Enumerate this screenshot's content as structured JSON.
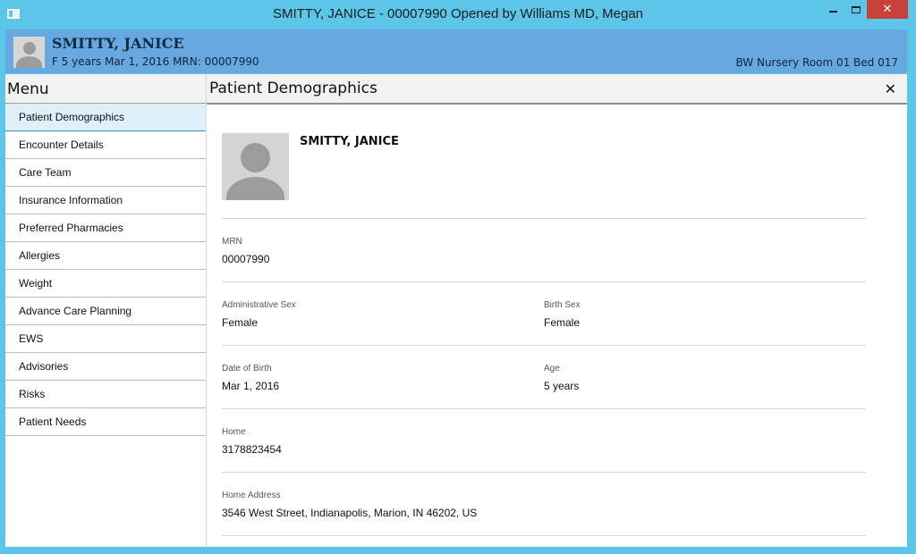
{
  "window": {
    "title": "SMITTY, JANICE - 00007990 Opened by Williams MD, Megan",
    "close_glyph": "✕"
  },
  "header": {
    "name": "SMITTY, JANICE",
    "details": "F 5 years Mar 1, 2016 MRN: 00007990",
    "location": "BW Nursery Room 01 Bed 017"
  },
  "menu": {
    "title": "Menu",
    "items": [
      {
        "label": "Patient Demographics"
      },
      {
        "label": "Encounter Details"
      },
      {
        "label": "Care Team"
      },
      {
        "label": "Insurance Information"
      },
      {
        "label": "Preferred Pharmacies"
      },
      {
        "label": "Allergies"
      },
      {
        "label": "Weight"
      },
      {
        "label": "Advance Care Planning"
      },
      {
        "label": "EWS"
      },
      {
        "label": "Advisories"
      },
      {
        "label": "Risks"
      },
      {
        "label": "Patient Needs"
      }
    ]
  },
  "content": {
    "title": "Patient Demographics",
    "close_glyph": "✕",
    "patient_name": "SMITTY, JANICE",
    "mrn": {
      "label": "MRN",
      "value": "00007990"
    },
    "admin_sex": {
      "label": "Administrative Sex",
      "value": "Female"
    },
    "birth_sex": {
      "label": "Birth Sex",
      "value": "Female"
    },
    "dob": {
      "label": "Date of Birth",
      "value": "Mar 1, 2016"
    },
    "age": {
      "label": "Age",
      "value": "5 years"
    },
    "home": {
      "label": "Home",
      "value": "3178823454"
    },
    "home_address": {
      "label": "Home Address",
      "value": "3546 West Street, Indianapolis, Marion, IN 46202, US"
    }
  },
  "colors": {
    "titlebar": "#5bc6e8",
    "header": "#68a8e0",
    "close_button": "#c7413a",
    "active_menu": "#e0f0fb"
  }
}
